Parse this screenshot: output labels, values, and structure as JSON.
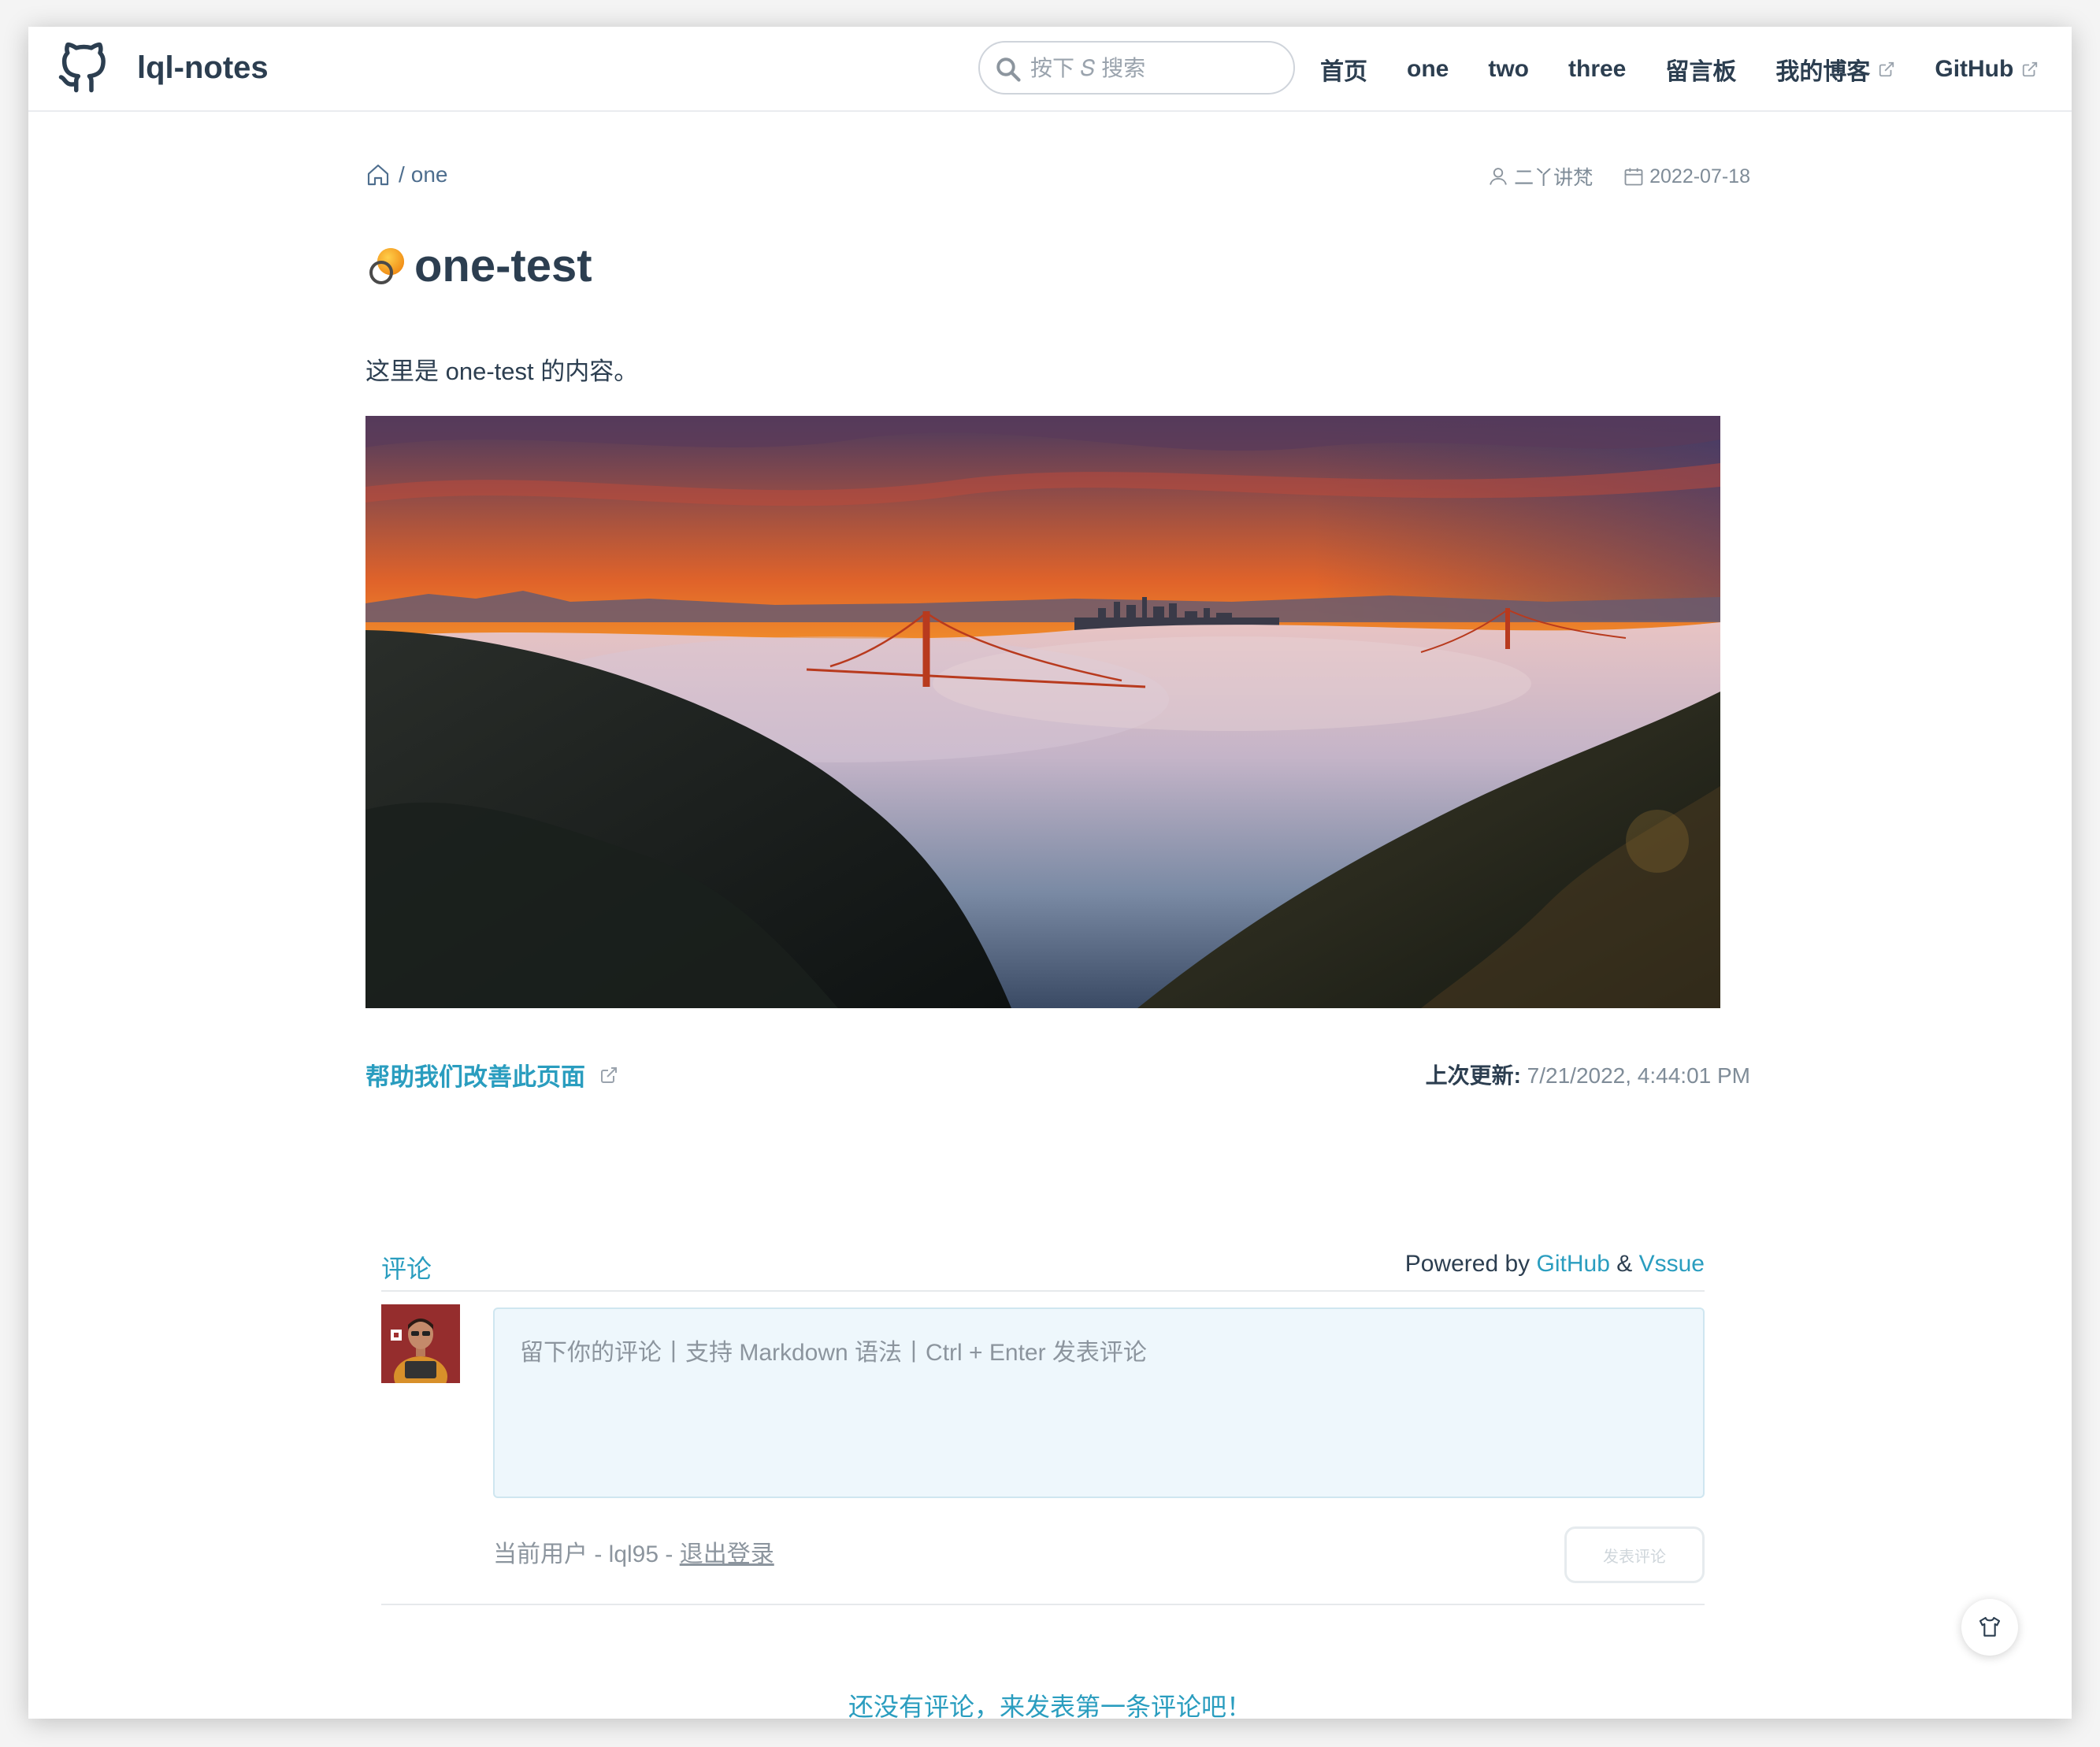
{
  "header": {
    "site_name": "lql-notes",
    "logo_icon": "github-cat-icon",
    "search_placeholder": "按下 𝑆 搜索",
    "nav": [
      {
        "label": "首页",
        "external": false
      },
      {
        "label": "one",
        "external": false
      },
      {
        "label": "two",
        "external": false
      },
      {
        "label": "three",
        "external": false
      },
      {
        "label": "留言板",
        "external": false
      },
      {
        "label": "我的博客",
        "external": true
      },
      {
        "label": "GitHub",
        "external": true
      }
    ]
  },
  "breadcrumb": {
    "home_icon": "home-icon",
    "separator": "/",
    "current": "one"
  },
  "meta": {
    "author": "二丫讲梵",
    "date": "2022-07-18"
  },
  "page": {
    "title": "one-test",
    "content": "这里是 one-test 的内容。",
    "image_alt": "Golden Gate Bridge above fog at sunset",
    "edit_link": "帮助我们改善此页面",
    "last_updated_label": "上次更新:",
    "last_updated_value": "7/21/2022, 4:44:01 PM"
  },
  "comments": {
    "title": "评论",
    "powered_prefix": "Powered by",
    "powered_github": "GitHub",
    "powered_amp": "&",
    "powered_vssue": "Vssue",
    "placeholder": "留下你的评论丨支持 Markdown 语法丨Ctrl + Enter 发表评论",
    "current_user_prefix": "当前用户 - lql95 -",
    "logout": "退出登录",
    "submit": "发表评论",
    "empty": "还没有评论，来发表第一条评论吧！"
  },
  "colors": {
    "accent": "#2a9dbf",
    "text": "#2c3e50",
    "muted": "#7f8c98",
    "comment_bg": "#eef7fc"
  }
}
